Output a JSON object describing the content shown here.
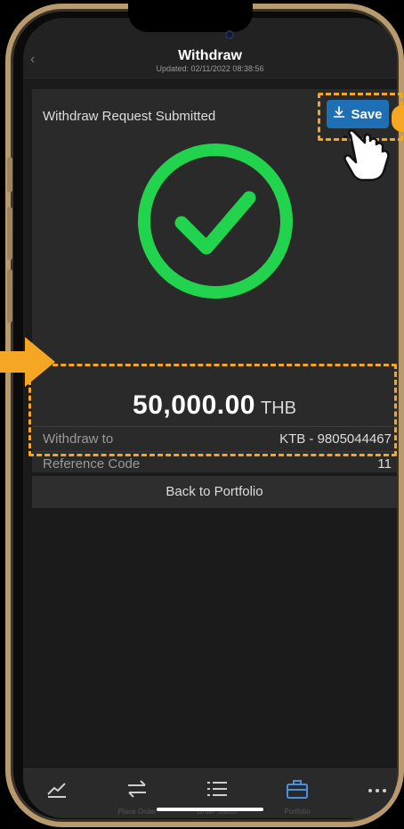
{
  "header": {
    "back_icon": "chevron-left-icon",
    "title": "Withdraw",
    "updated": "Updated: 02/11/2022 08:38:56"
  },
  "status": {
    "label": "Withdraw Request Submitted",
    "save_label": "Save",
    "save_icon": "download-icon",
    "success_icon": "check-circle-icon",
    "success_color": "#22d34d"
  },
  "amount": {
    "value": "50,000.00",
    "currency": "THB"
  },
  "details": [
    {
      "label": "Withdraw to",
      "value": "KTB - 9805044467"
    },
    {
      "label": "Reference Code",
      "value": "11"
    }
  ],
  "actions": {
    "back_to_portfolio": "Back to Portfolio"
  },
  "tabbar": {
    "items": [
      {
        "icon": "chart-line-icon",
        "label": "",
        "active": false
      },
      {
        "icon": "swap-arrows-icon",
        "label": "Place Order",
        "active": false
      },
      {
        "icon": "list-icon",
        "label": "Order Status",
        "active": false
      },
      {
        "icon": "briefcase-icon",
        "label": "Portfolio",
        "active": true
      },
      {
        "icon": "more-icon",
        "label": "",
        "active": false
      }
    ]
  },
  "colors": {
    "accent": "#1f6fb5",
    "highlight": "#f5a623",
    "active_tab": "#4a8fe0"
  }
}
